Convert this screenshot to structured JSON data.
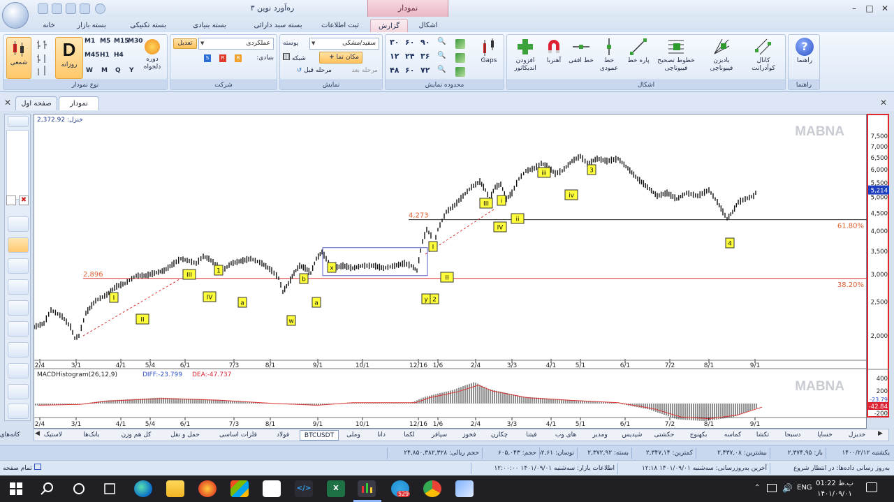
{
  "app": {
    "title": "رەآورد نوین ۳",
    "context_tab": "نمودار",
    "window_controls": [
      "minimize",
      "restore",
      "close"
    ]
  },
  "ribbon_tabs": [
    {
      "label": "خانه"
    },
    {
      "label": "بسته بازار"
    },
    {
      "label": "بسته تکنیکی"
    },
    {
      "label": "بسته بنیادی"
    },
    {
      "label": "بسته سبد دارائی"
    },
    {
      "label": "ثبت اطلاعات"
    },
    {
      "label": "گزارش"
    },
    {
      "label": "اشکال"
    }
  ],
  "groups": {
    "chart_type": {
      "label": "نوع نمودار",
      "candle": "شمعی",
      "daily": "روزانه",
      "daily_letter": "D",
      "custom_period": "دوره دلخواه",
      "periods": [
        "M1",
        "M5",
        "M15",
        "M30",
        "M45",
        "H1",
        "H4",
        "W",
        "M",
        "Q",
        "Y"
      ]
    },
    "company": {
      "label": "شرکت",
      "edit": "تعدیل",
      "operational": "عملکردی",
      "fundamental": "بنیادی:",
      "flags": [
        "S",
        "R",
        "B"
      ]
    },
    "display": {
      "label": "نمایش",
      "skin_label": "پوسته",
      "skin_value": "سفید/مشکی",
      "grid": "شبکه",
      "crosshair": "مکان نما",
      "prev_step": "مرحله قبل",
      "next_step": "مرحله بعد"
    },
    "display_range": {
      "label": "محدوده نمایش",
      "values": [
        "۳۰",
        "۶۰",
        "۹۰",
        "۱۲",
        "۲۴",
        "۳۶",
        "۴۸",
        "۶۰",
        "۷۲"
      ],
      "gaps": "Gaps"
    },
    "shapes": {
      "label": "اشکال",
      "add_indicator": "افزودن اندیکاتور",
      "magnet": "آهنربا",
      "h_line": "خط افقی",
      "v_line": "خط عمودی",
      "segment": "پاره خط",
      "fib_retrace": "خطوط تصحیح فیبوناچی",
      "fib_fan": "بادبزن فیبوناچی",
      "channel": "کانال کوآدرانت"
    },
    "help": {
      "label": "راهنما",
      "button": "راهنما"
    }
  },
  "doc_tabs": [
    {
      "label": "نمودار"
    },
    {
      "label": "صفحه اول"
    }
  ],
  "chart": {
    "watermark": "MABNA",
    "last_price_label": "خنزل: 2,372.92",
    "macd_label": "MACDHistogram(26,12,9)",
    "diff_label": "DIFF:-23.799",
    "dea_label": "DEA:-47.737",
    "current_price": "5,214",
    "macd_current": "-42.84",
    "macd_current_diff": "-23.79",
    "fib_levels": [
      {
        "label": "61.80%",
        "price": 4273,
        "price_label": "4,273"
      },
      {
        "label": "38.20%",
        "price": 2896,
        "price_label": "2,896"
      }
    ],
    "price_ticks": [
      "7,500",
      "7,000",
      "6,500",
      "6,000",
      "5,500",
      "5,000",
      "4,500",
      "4,000",
      "3,500",
      "3,000",
      "2,500",
      "2,000"
    ],
    "macd_ticks": [
      "400",
      "200",
      "-200"
    ],
    "date_ticks": [
      "2/4",
      "3/1",
      "4/1",
      "5/4",
      "6/1",
      "7/3",
      "8/1",
      "9/1",
      "10/1",
      "12/16",
      "1/6",
      "2/4",
      "3/3",
      "4/1",
      "5/1",
      "6/1",
      "7/2",
      "8/1",
      "9/1"
    ],
    "wave_labels": [
      "I",
      "II",
      "III",
      "IV",
      "1",
      "a",
      "w",
      "b",
      "a",
      "x",
      "y",
      "2",
      "I",
      "II",
      "III",
      "IV",
      "i",
      "ii",
      "iii",
      "iv",
      "3",
      "4"
    ]
  },
  "sheet_tabs": [
    "خدیزل",
    "خساپا",
    "دسبحا",
    "تکشا",
    "کماسه",
    "بکهنوج",
    "حکشتی",
    "شپدیس",
    "ومدیر",
    "های وب",
    "فیتنا",
    "چکارن",
    "فخوز",
    "سپافر",
    "لکما",
    "دانا",
    "وملی",
    "BTCUSDT",
    "فولاد",
    "فلزات اساسی",
    "حمل و نقل",
    "کل هم وزن",
    "بانک‌ها",
    "لاستیک",
    "کانه‌های فلزی"
  ],
  "selected_sheet": "BTCUSDT",
  "status_bar": {
    "date": "یکشنبه ۱۴۰۰/۲/۱۲",
    "open": "باز: ۲,۳۷۴,۹۵",
    "high": "بیشترین: ۲,۴۳۷,۰۸",
    "low": "کمترین: ۲,۳۴۷,۱۴",
    "close": "بسته: ۲,۳۷۲,۹۲",
    "change": "نوسان: ۲,۶۱%",
    "volume": "حجم: ۶۰۵,۰۴۳",
    "value": "حجم ریالی: ۲۴,۸۵۰,۳۸۲,۳۲۸"
  },
  "status_bar2": {
    "update": "به‌روز رسانی داده‌ها: در انتظار شروع",
    "last_update": "آخرین به‌روزرسانی: سه‌شنبه ۱۴۰۱/۰۹/۰۱ ۱۲:۱۸",
    "market_info": "اطلاعات بازار: سه‌شنبه ۱۴۰۱/۰۹/۰۱ ۱۲:۰۰:۰۰",
    "full_page": "تمام صفحه"
  },
  "taskbar": {
    "lang": "ENG",
    "time": "01:22 ب.ظ",
    "date": "۱۴۰۱/۰۹/۰۱",
    "telegram_badge": "529"
  }
}
